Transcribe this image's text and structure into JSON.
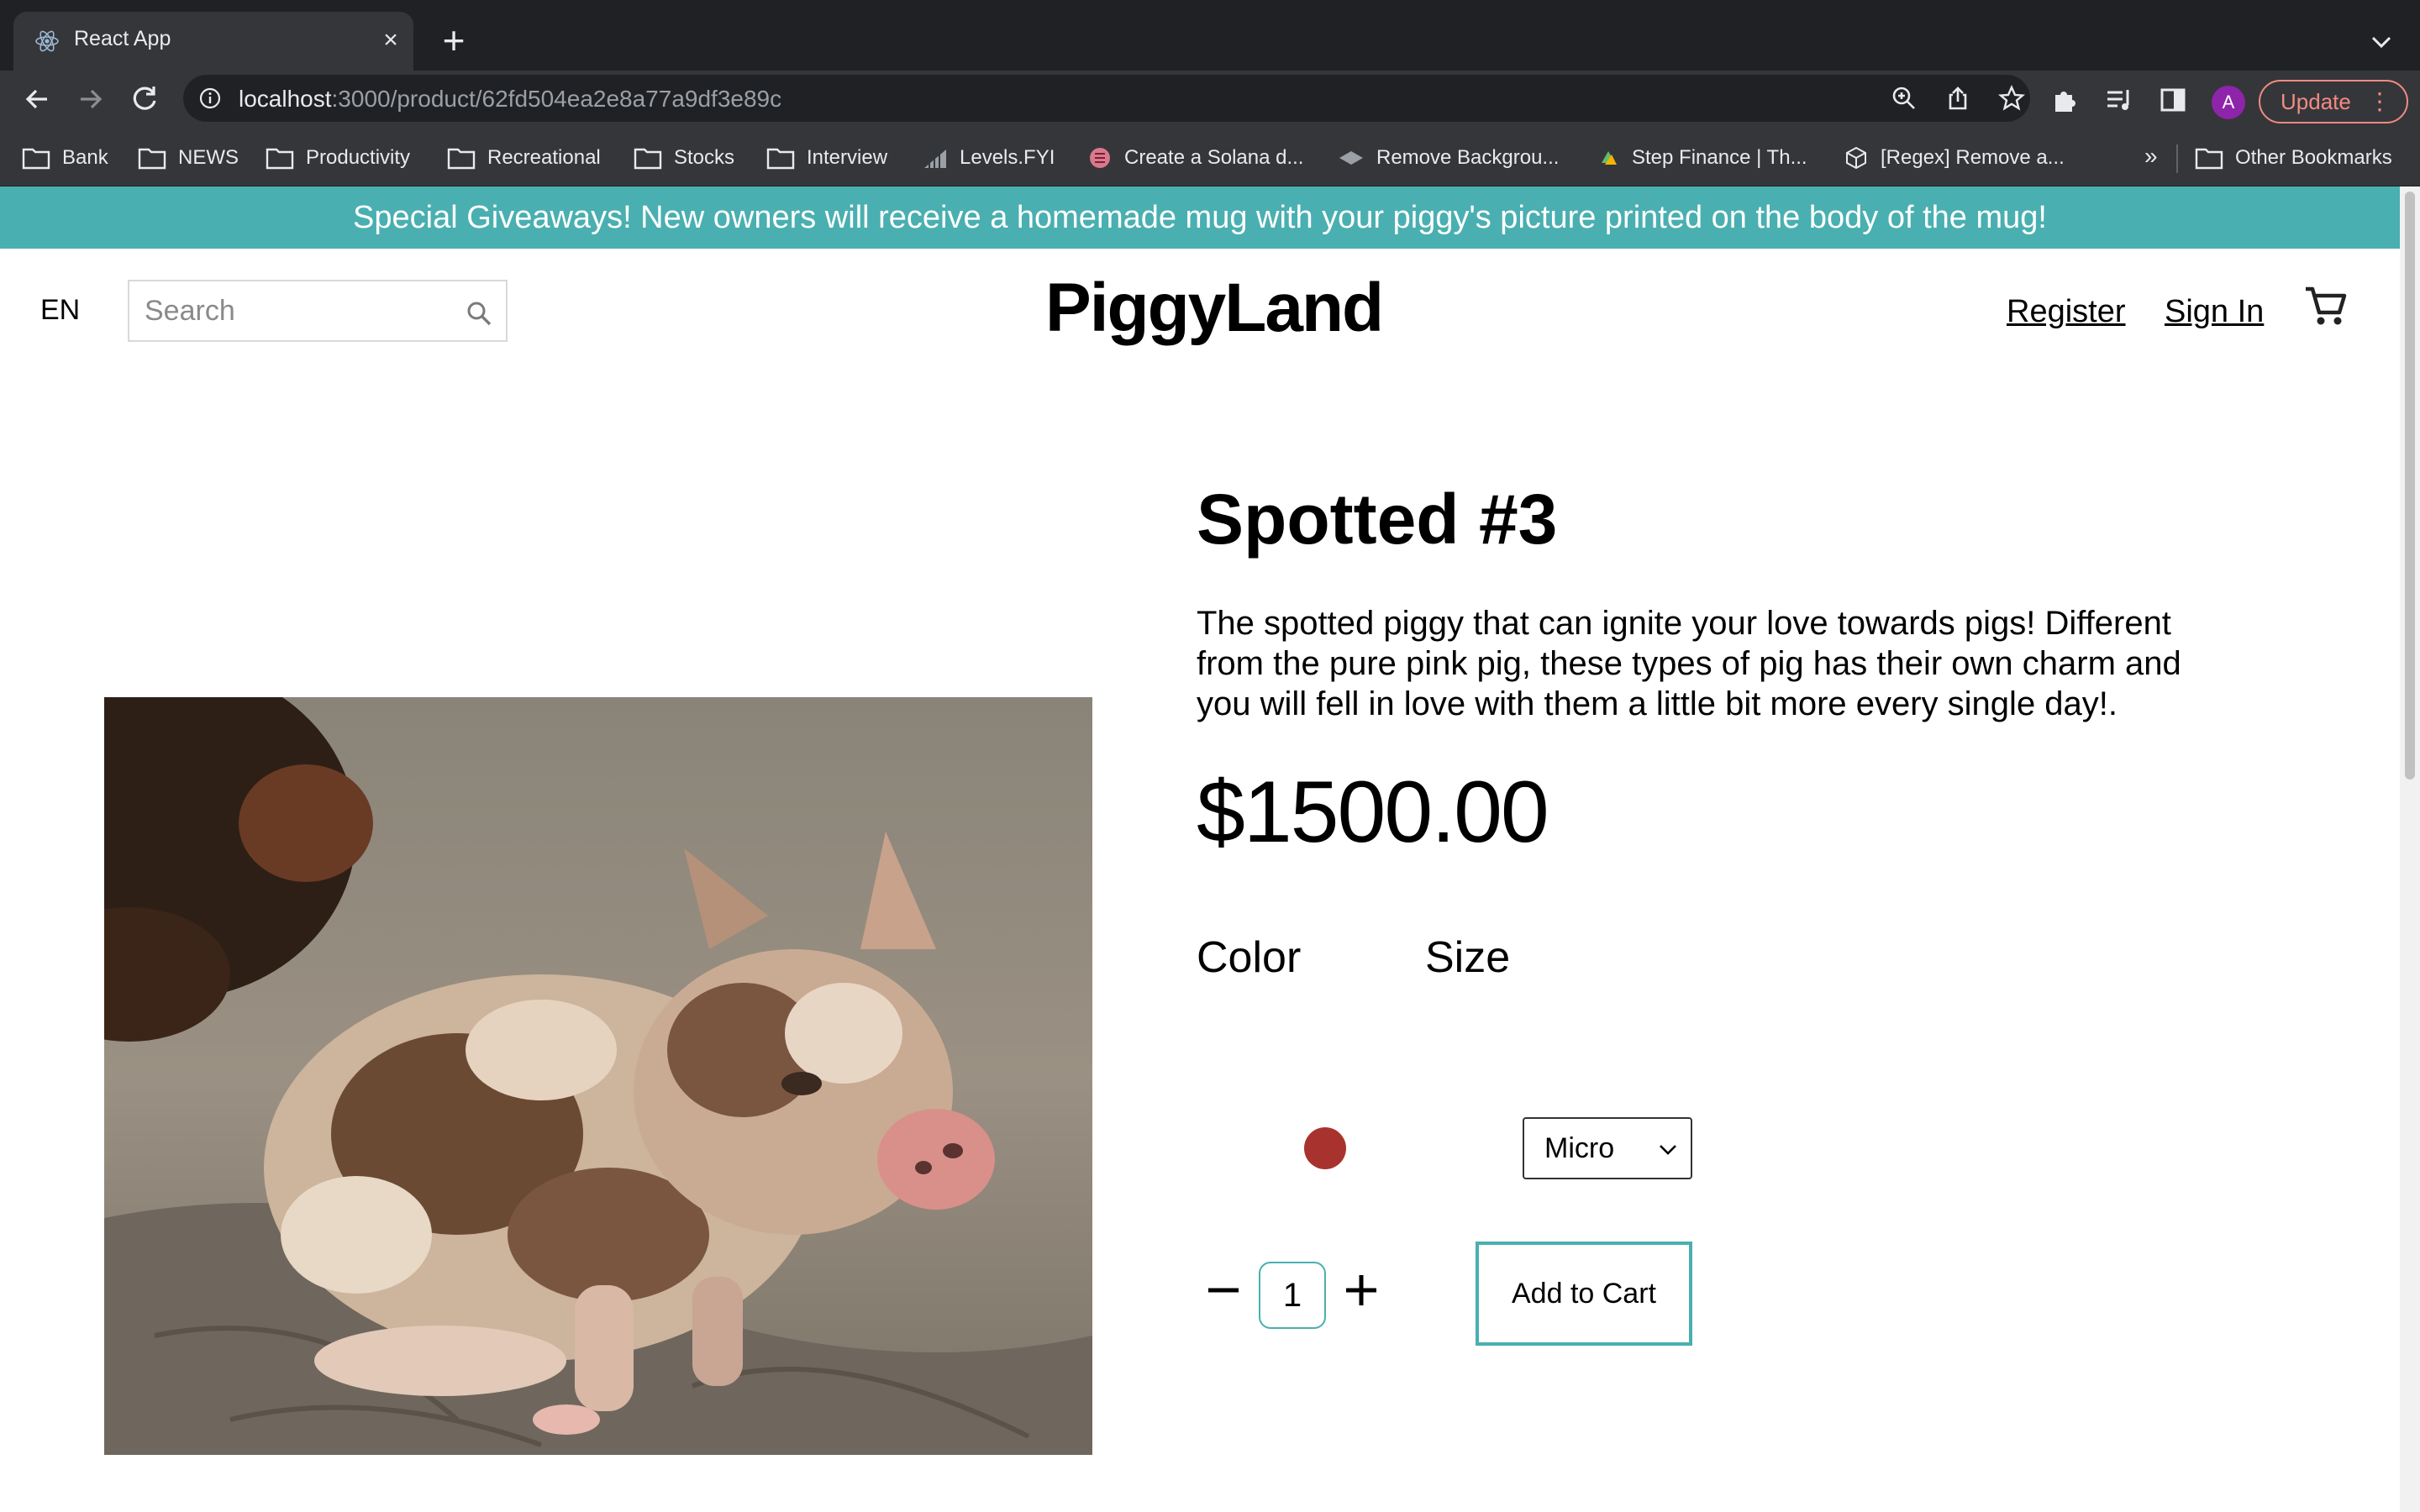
{
  "browser": {
    "tab_title": "React App",
    "url_host": "localhost",
    "url_path": ":3000/product/62fd504ea2e8a77a9df3e89c",
    "avatar_letter": "A",
    "update_label": "Update",
    "bookmarks": [
      {
        "label": "Bank",
        "icon": "folder-icon"
      },
      {
        "label": "NEWS",
        "icon": "folder-icon"
      },
      {
        "label": "Productivity",
        "icon": "folder-icon"
      },
      {
        "label": "Recreational",
        "icon": "folder-icon"
      },
      {
        "label": "Stocks",
        "icon": "folder-icon"
      },
      {
        "label": "Interview",
        "icon": "folder-icon"
      },
      {
        "label": "Levels.FYI",
        "icon": "levels-favicon"
      },
      {
        "label": "Create a Solana d...",
        "icon": "solana-favicon"
      },
      {
        "label": "Remove Backgrou...",
        "icon": "removebg-favicon"
      },
      {
        "label": "Step Finance | Th...",
        "icon": "step-favicon"
      },
      {
        "label": "[Regex] Remove a...",
        "icon": "regex-favicon"
      }
    ],
    "bookmarks_overflow": "»",
    "other_bookmarks": "Other Bookmarks"
  },
  "site": {
    "announcement": "Special Giveaways! New owners will receive a homemade mug with your piggy's picture printed on the body of the mug!",
    "lang": "EN",
    "search_placeholder": "Search",
    "logo": "PiggyLand",
    "register": "Register",
    "sign_in": "Sign In"
  },
  "product": {
    "title": "Spotted #3",
    "description": "The spotted piggy that can ignite your love towards pigs! Different from the pure pink pig, these types of pig has their own charm and you will fell in love with them a little bit more every single day!.",
    "price": "$1500.00",
    "color_label": "Color",
    "color_value": "#a8332e",
    "size_label": "Size",
    "size_selected": "Micro",
    "quantity": "1",
    "add_to_cart": "Add to Cart"
  },
  "colors": {
    "accent": "#4aafb0",
    "chrome_dark": "#202124",
    "chrome_mid": "#35363a"
  }
}
